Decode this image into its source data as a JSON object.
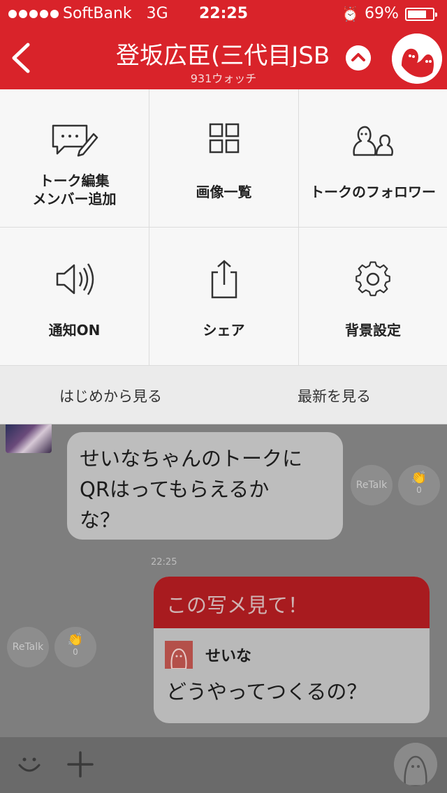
{
  "status_bar": {
    "carrier": "SoftBank",
    "network": "3G",
    "time": "22:25",
    "battery": "69%",
    "battery_level": 0.69
  },
  "header": {
    "title": "登坂広臣(三代目JSB",
    "subtitle": "931ウォッチ",
    "back_icon": "chevron-left-icon",
    "collapse_icon": "chevron-up-icon"
  },
  "menu": {
    "items": [
      {
        "line1": "トーク編集",
        "line2": "メンバー追加",
        "icon": "chat-edit-icon"
      },
      {
        "line1": "画像一覧",
        "icon": "grid-icon"
      },
      {
        "line1": "トークのフォロワー",
        "icon": "people-icon"
      },
      {
        "line1": "通知ON",
        "icon": "speaker-icon"
      },
      {
        "line1": "シェア",
        "icon": "share-icon"
      },
      {
        "line1": "背景設定",
        "icon": "gear-icon"
      }
    ]
  },
  "jump": {
    "from_start": "はじめから見る",
    "latest": "最新を見る"
  },
  "chat": {
    "incoming": {
      "text_line1": "せいなちゃんのトークに",
      "text_line2": "QRはってもらえるか",
      "text_line3": "な？",
      "retalk": "ReTalk",
      "clap_count": "0"
    },
    "timestamp": "22:25",
    "outgoing": {
      "header": "この写メ見て！",
      "quote_name": "せいな",
      "quote_text": "どうやってつくるの？",
      "retalk": "ReTalk",
      "clap_count": "0"
    }
  },
  "colors": {
    "brand_red": "#d9232a"
  }
}
